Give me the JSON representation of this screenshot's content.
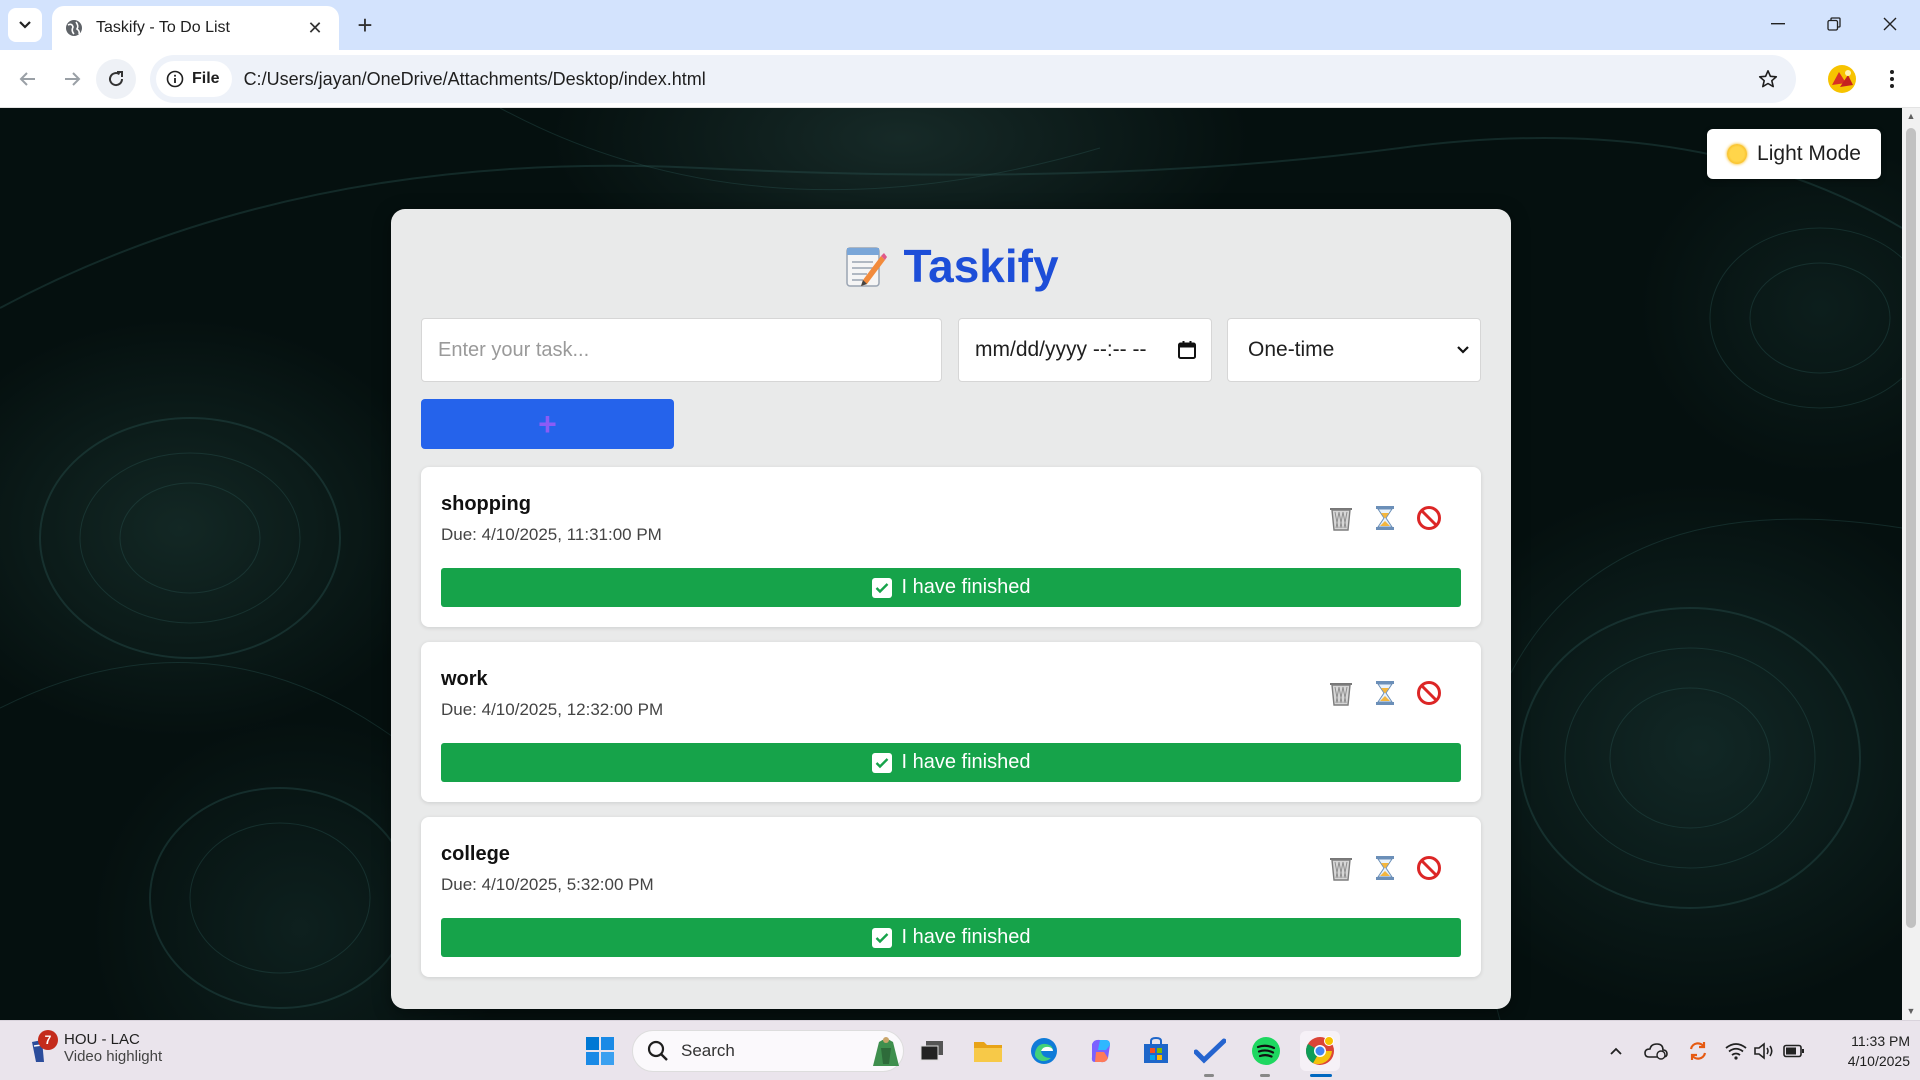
{
  "browser": {
    "tab_title": "Taskify - To Do List",
    "file_chip": "File",
    "url": "C:/Users/jayan/OneDrive/Attachments/Desktop/index.html"
  },
  "page": {
    "mode_button": "Light Mode",
    "app_name": "Taskify",
    "task_input_placeholder": "Enter your task...",
    "datetime_placeholder": "mm/dd/yyyy --:-- --",
    "repeat_select_value": "One-time",
    "add_button": "+",
    "finish_label": "I have finished",
    "tasks": [
      {
        "name": "shopping",
        "due": "Due: 4/10/2025, 11:31:00 PM"
      },
      {
        "name": "work",
        "due": "Due: 4/10/2025, 12:32:00 PM"
      },
      {
        "name": "college",
        "due": "Due: 4/10/2025, 5:32:00 PM"
      }
    ],
    "task_actions": [
      "trash-icon",
      "hourglass-icon",
      "prohibited-icon"
    ],
    "colors": {
      "accent": "#1d4ed8",
      "add_button": "#2563eb",
      "finish": "#16a34a"
    }
  },
  "taskbar": {
    "weather_badge": "7",
    "weather_line1": "HOU - LAC",
    "weather_line2": "Video highlight",
    "search_label": "Search",
    "time": "11:33 PM",
    "date": "4/10/2025"
  }
}
